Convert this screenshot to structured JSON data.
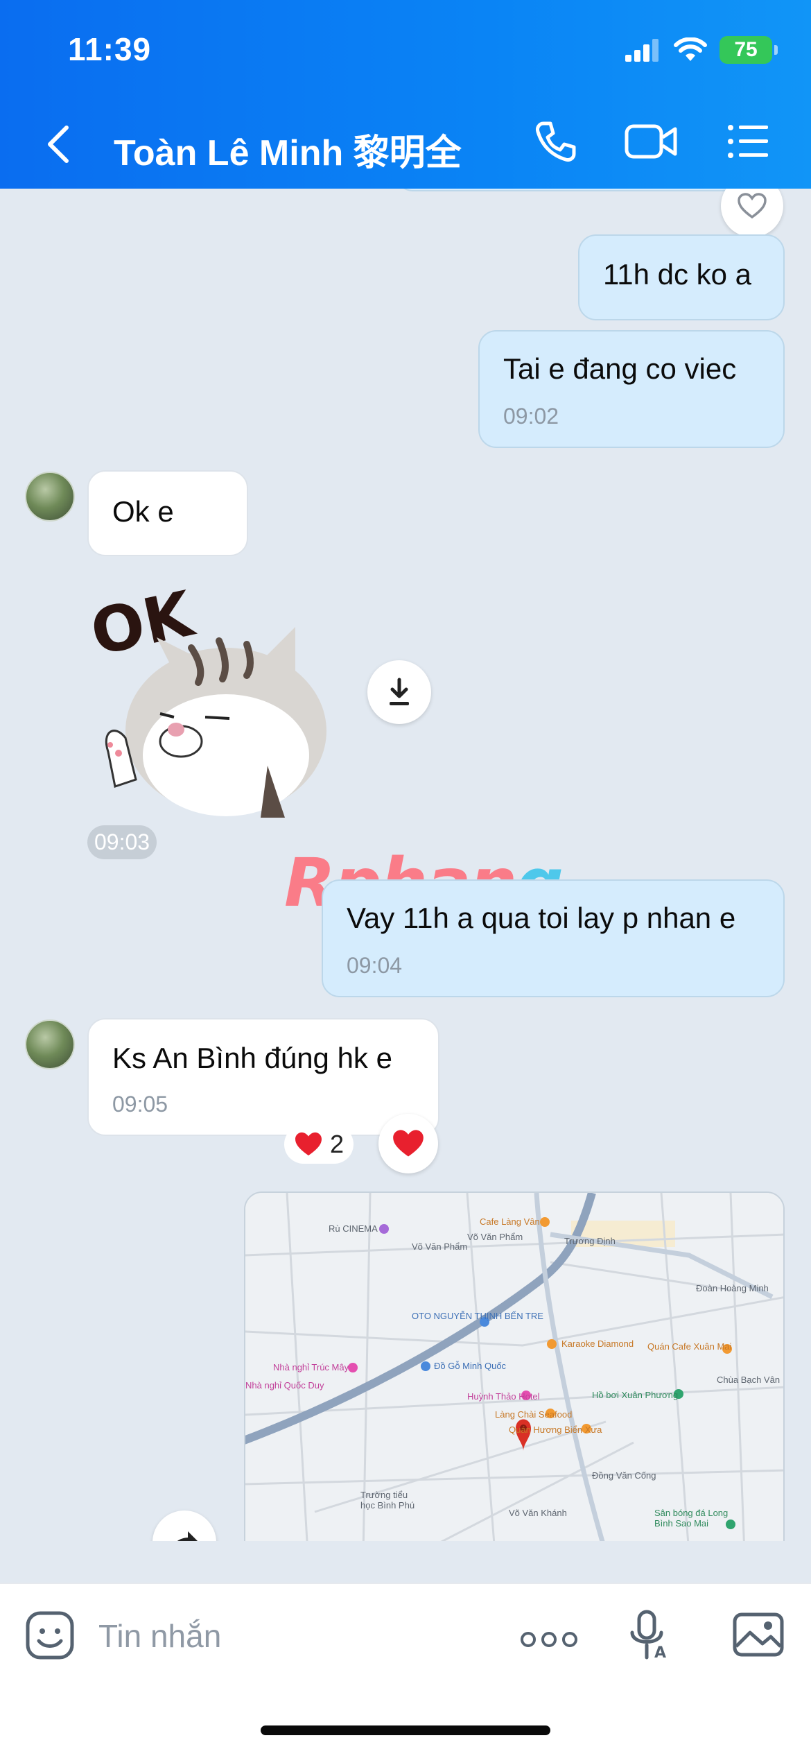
{
  "status": {
    "time": "11:39",
    "battery": "75"
  },
  "header": {
    "contact_name": "Toàn Lê Minh 黎明全"
  },
  "messages": [
    {
      "text": "11h dc ko a"
    },
    {
      "text": "Tai e đang co viec",
      "time": "09:02"
    },
    {
      "text": "Ok e"
    },
    {
      "sticker_time": "09:03"
    },
    {
      "text": "Vay 11h a qua toi lay p nhan e",
      "time": "09:04"
    },
    {
      "text": "Ks An Bình đúng hk e",
      "time": "09:05",
      "reaction_count": "2"
    }
  ],
  "watermark": {
    "part1": "Rphan",
    "part2": "g"
  },
  "map": {
    "labels": [
      "Rù CINEMA",
      "Cafe Làng Vân",
      "Trương Định",
      "Võ Văn Phẩm",
      "Võ Văn Phẩm",
      "OTO NGUYỄN THỊNH BẾN TRE",
      "Đồ Gỗ Minh Quốc",
      "Karaoke Diamond",
      "Quán Cafe Xuân Mai",
      "Nhà nghỉ Trúc Mây",
      "Nhà nghỉ Quốc Duy",
      "Hồ bơi Xuân Phương",
      "Chùa Bạch Vân",
      "Huỳnh Thảo Hotel",
      "Làng Chài Seafood",
      "Quán Hương Biển Xưa",
      "Trường tiểu học Bình Phú",
      "Võ Văn Khánh",
      "Sân bóng đá Long Bình Sao Mai",
      "Đồng Văn Cống",
      "Đoàn Hoàng Minh"
    ]
  },
  "input": {
    "placeholder": "Tin nhắn"
  },
  "colors": {
    "header": "#0a84f5",
    "outgoing": "#d5ecfd",
    "incoming": "#ffffff",
    "background": "#e2e9f1"
  }
}
